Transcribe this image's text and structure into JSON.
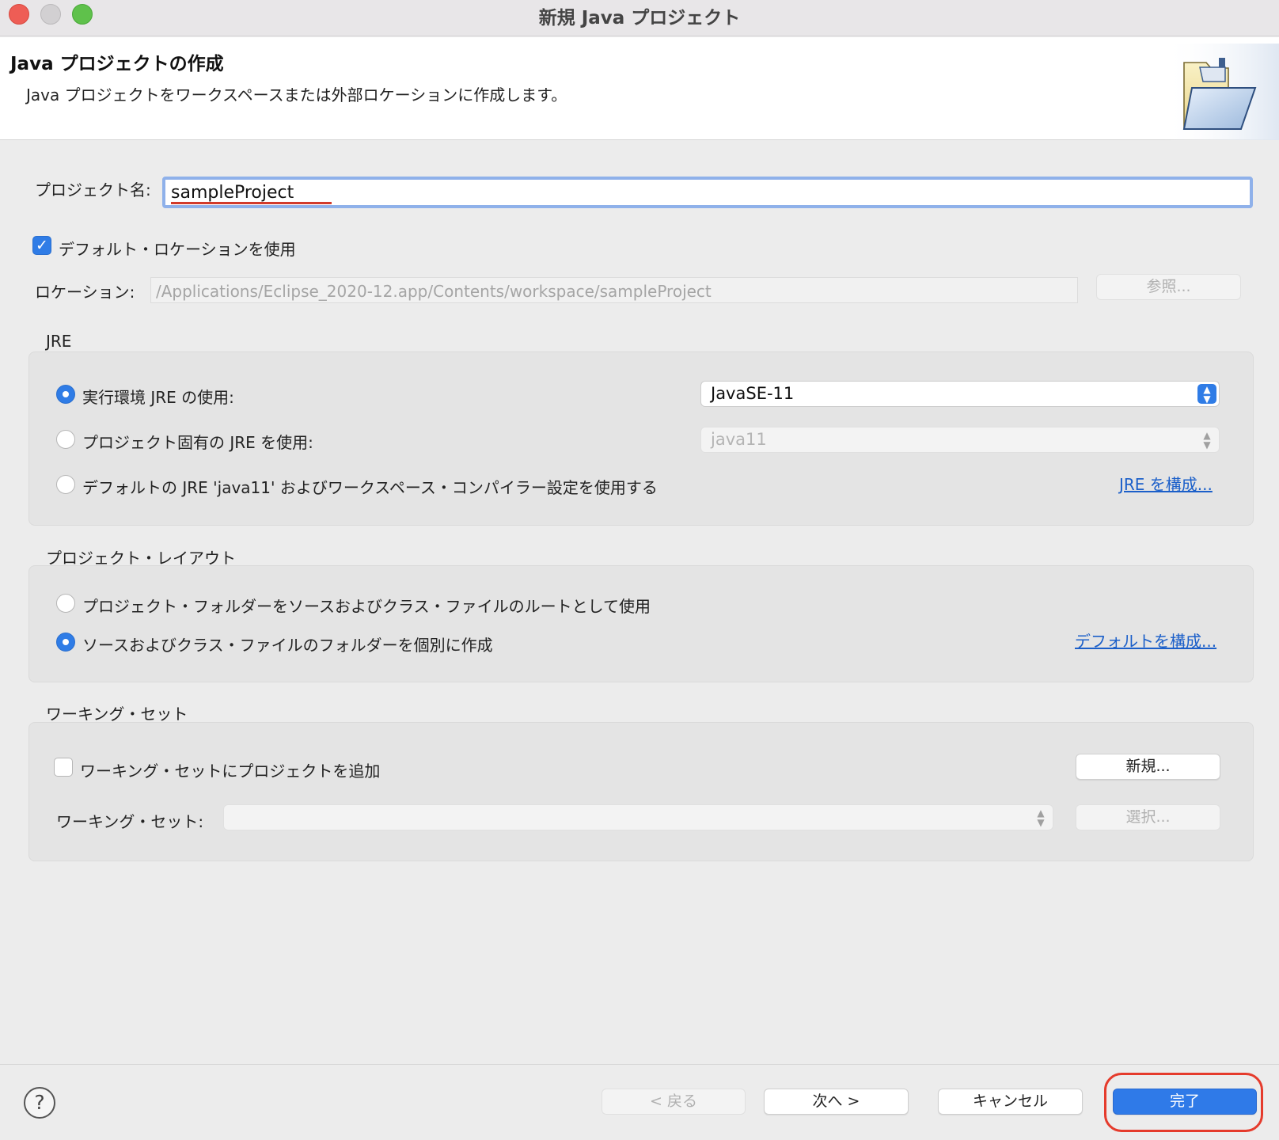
{
  "window": {
    "title": "新規 Java プロジェクト"
  },
  "header": {
    "title": "Java プロジェクトの作成",
    "description": "Java プロジェクトをワークスペースまたは外部ロケーションに作成します。",
    "icon": "folder-icon"
  },
  "project": {
    "name_label": "プロジェクト名:",
    "name_value": "sampleProject",
    "use_default_location_label": "デフォルト・ロケーションを使用",
    "use_default_location_checked": true,
    "location_label": "ロケーション:",
    "location_value": "/Applications/Eclipse_2020-12.app/Contents/workspace/sampleProject",
    "browse_label": "参照..."
  },
  "jre": {
    "group_label": "JRE",
    "options": [
      {
        "label": "実行環境 JRE の使用:",
        "selected": true
      },
      {
        "label": "プロジェクト固有の JRE を使用:",
        "selected": false
      },
      {
        "label": "デフォルトの JRE 'java11' およびワークスペース・コンパイラー設定を使用する",
        "selected": false
      }
    ],
    "execution_env_value": "JavaSE-11",
    "project_jre_value": "java11",
    "configure_link": "JRE を構成..."
  },
  "layout": {
    "group_label": "プロジェクト・レイアウト",
    "options": [
      {
        "label": "プロジェクト・フォルダーをソースおよびクラス・ファイルのルートとして使用",
        "selected": false
      },
      {
        "label": "ソースおよびクラス・ファイルのフォルダーを個別に作成",
        "selected": true
      }
    ],
    "configure_link": "デフォルトを構成..."
  },
  "working_set": {
    "group_label": "ワーキング・セット",
    "add_label": "ワーキング・セットにプロジェクトを追加",
    "add_checked": false,
    "new_button": "新規...",
    "sets_label": "ワーキング・セット:",
    "sets_value": "",
    "select_button": "選択..."
  },
  "footer": {
    "help": "?",
    "back": "< 戻る",
    "next": "次へ >",
    "cancel": "キャンセル",
    "finish": "完了"
  },
  "colors": {
    "accent": "#2f7ce6",
    "highlight_ring": "#e53b2c",
    "link": "#1b5fc9"
  }
}
